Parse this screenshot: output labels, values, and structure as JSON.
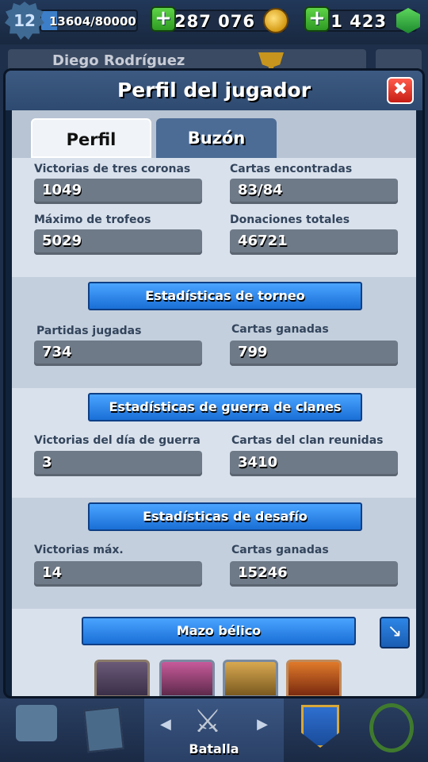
{
  "topbar": {
    "level": "12",
    "xp": "13604/80000",
    "xp_progress": 0.17,
    "gold": "287 076",
    "gems": "1 423"
  },
  "namebar": {
    "player_name": "Diego Rodríguez"
  },
  "modal": {
    "title": "Perfil del jugador",
    "close_label": "✖"
  },
  "tabs": {
    "profile": "Perfil",
    "inbox": "Buzón"
  },
  "profile_stats": {
    "three_crown_wins_label": "Victorias de tres coronas",
    "three_crown_wins": "1049",
    "cards_found_label": "Cartas encontradas",
    "cards_found": "83/84",
    "highest_trophies_label": "Máximo de trofeos",
    "highest_trophies": "5029",
    "total_donations_label": "Donaciones totales",
    "total_donations": "46721"
  },
  "tournament": {
    "heading": "Estadísticas de torneo",
    "games_played_label": "Partidas jugadas",
    "games_played": "734",
    "cards_won_label": "Cartas ganadas",
    "cards_won": "799"
  },
  "clan_war": {
    "heading": "Estadísticas de guerra de clanes",
    "war_day_wins_label": "Victorias del día de guerra",
    "war_day_wins": "3",
    "clan_cards_label": "Cartas del clan reunidas",
    "clan_cards": "3410"
  },
  "challenge": {
    "heading": "Estadísticas de desafío",
    "max_wins_label": "Victorias máx.",
    "max_wins": "14",
    "cards_won_label": "Cartas ganadas",
    "cards_won": "15246"
  },
  "war_deck": {
    "heading": "Mazo bélico"
  },
  "bottomnav": {
    "battle_label": "Batalla",
    "prev_arrow": "◀",
    "next_arrow": "▶"
  },
  "colors": {
    "ribbon_blue": "#1a6fd6",
    "stat_box": "#6f7a88",
    "close_red": "#c61e16",
    "plus_green": "#2e9a23"
  }
}
